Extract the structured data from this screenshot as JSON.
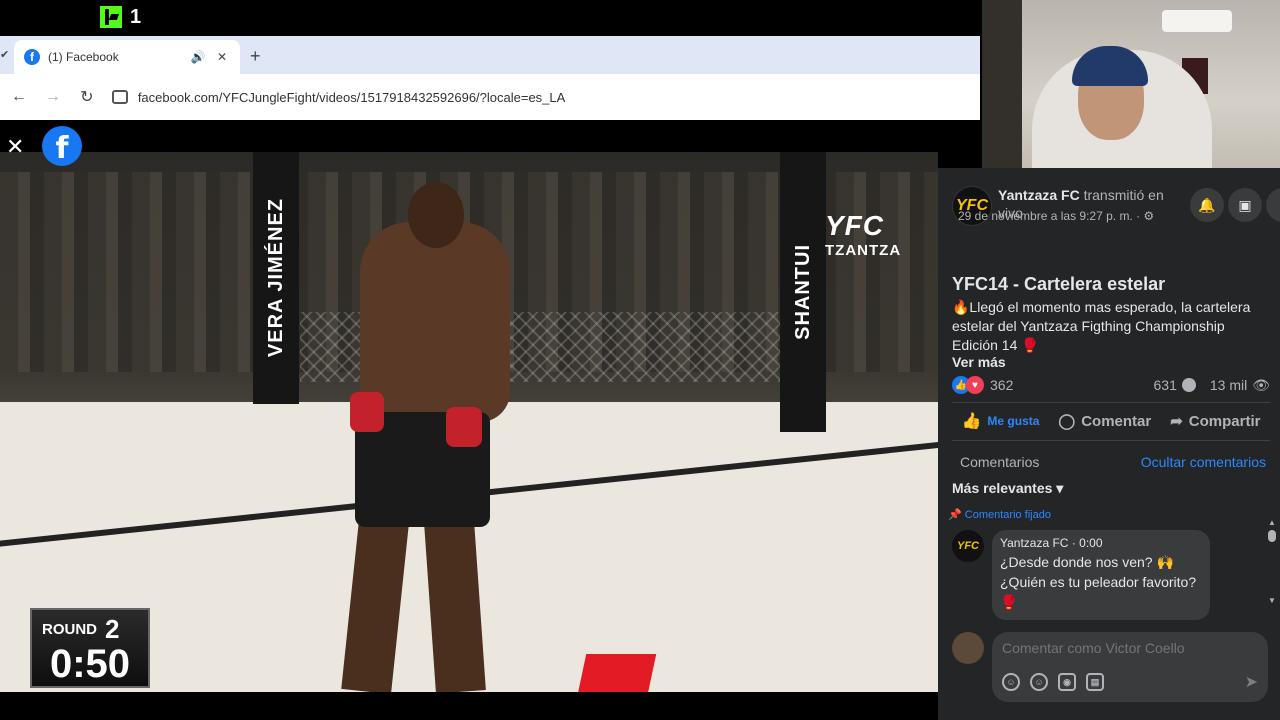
{
  "overlay": {
    "viewer_count": "1"
  },
  "browser": {
    "tab_title": "(1) Facebook",
    "favicon_letter": "f",
    "new_tab": "+",
    "url": "facebook.com/YFCJungleFight/videos/1517918432592696/?locale=es_LA"
  },
  "video": {
    "close": "✕",
    "fb_logo": "f",
    "scoreboard": {
      "label": "ROUND",
      "round": "2",
      "time": "0:50"
    },
    "logo_main": "YFC",
    "logo_sub": "TZANTZA",
    "post_text_left": "VERA JIMÉNEZ",
    "post_text_right": "SHANTUI"
  },
  "panel": {
    "page_name": "Yantzaza FC",
    "action_text": " transmitió en vivo.",
    "date": "29 de noviembre a las 9:27 p. m. · ⚙",
    "avatar_text": "YFC",
    "title": "YFC14 - Cartelera estelar",
    "description": "🔥Llegó el momento mas esperado, la cartelera estelar del Yantzaza Figthing Championship Edición 14 🥊",
    "see_more": "Ver más",
    "reactions_count": "362",
    "comments_count": "631",
    "views_count": "13 mil",
    "like_label": "Me gusta",
    "comment_label": "Comentar",
    "share_label": "Compartir",
    "comments_heading": "Comentarios",
    "hide_comments": "Ocultar comentarios",
    "sort_label": "Más relevantes",
    "pinned_label": "Comentario fijado",
    "comment": {
      "author": "Yantzaza FC",
      "time": "0:00",
      "line1": "¿Desde donde nos ven? 🙌",
      "line2": "¿Quién es tu peleador favorito?",
      "line3": "🥊"
    },
    "composer_placeholder": "Comentar como Victor Coello"
  },
  "colors": {
    "facebook_blue": "#1877f2",
    "panel_bg": "#242526",
    "kick_green": "#53fc18",
    "accent_red": "#e21b24"
  }
}
